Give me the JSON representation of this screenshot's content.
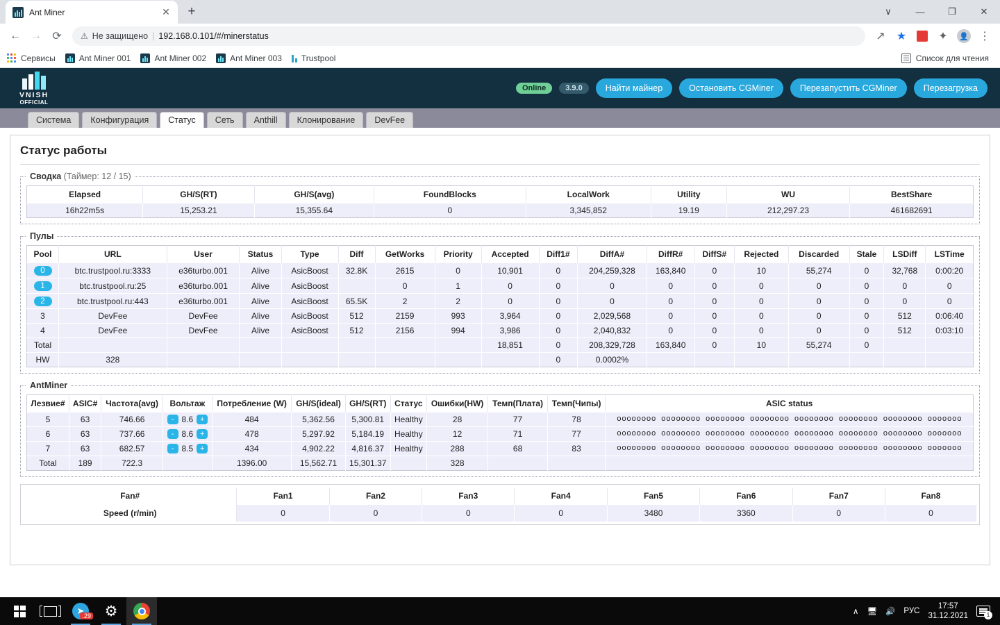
{
  "browser": {
    "tab": {
      "title": "Ant Miner",
      "close_label": "✕"
    },
    "new_tab_label": "+",
    "window_controls": {
      "minimize_tabs": "∨",
      "minimize": "—",
      "maximize": "❐",
      "close": "✕"
    },
    "nav": {
      "back": "←",
      "forward": "→",
      "reload": "⟳"
    },
    "omnibox": {
      "security_icon": "⚠",
      "security_label": "Не защищено",
      "separator": "|",
      "url": "192.168.0.101/#/minerstatus"
    },
    "toolbar_right": {
      "share": "↗",
      "bookmark_star": "★",
      "extension_red": "●",
      "extensions_puzzle": "✦",
      "profile": "●",
      "menu": "⋮"
    },
    "bookmarks": [
      {
        "label": "Сервисы",
        "icon": "apps-grid-icon"
      },
      {
        "label": "Ant Miner 001",
        "icon": "vnish-favicon"
      },
      {
        "label": "Ant Miner 002",
        "icon": "vnish-favicon"
      },
      {
        "label": "Ant Miner 003",
        "icon": "vnish-favicon"
      },
      {
        "label": "Trustpool",
        "icon": "bars-icon"
      }
    ],
    "reading_list": "Список для чтения"
  },
  "app": {
    "logo": {
      "text": "VNISH",
      "sub": "OFFICIAL"
    },
    "status_pill": "Online",
    "version_pill": "3.9.0",
    "buttons": [
      "Найти майнер",
      "Остановить CGMiner",
      "Перезапустить CGMiner",
      "Перезагрузка"
    ],
    "tabs": [
      {
        "label": "Система",
        "active": false
      },
      {
        "label": "Конфигурация",
        "active": false
      },
      {
        "label": "Статус",
        "active": true
      },
      {
        "label": "Сеть",
        "active": false
      },
      {
        "label": "Anthill",
        "active": false
      },
      {
        "label": "Клонирование",
        "active": false
      },
      {
        "label": "DevFee",
        "active": false
      }
    ],
    "page_title": "Статус работы"
  },
  "summary": {
    "legend": "Сводка",
    "legend_soft": "(Таймер: 12 / 15)",
    "headers": [
      "Elapsed",
      "GH/S(RT)",
      "GH/S(avg)",
      "FoundBlocks",
      "LocalWork",
      "Utility",
      "WU",
      "BestShare"
    ],
    "row": [
      "16h22m5s",
      "15,253.21",
      "15,355.64",
      "0",
      "3,345,852",
      "19.19",
      "212,297.23",
      "461682691"
    ]
  },
  "pools": {
    "legend": "Пулы",
    "headers": [
      "Pool",
      "URL",
      "User",
      "Status",
      "Type",
      "Diff",
      "GetWorks",
      "Priority",
      "Accepted",
      "Diff1#",
      "DiffA#",
      "DiffR#",
      "DiffS#",
      "Rejected",
      "Discarded",
      "Stale",
      "LSDiff",
      "LSTime"
    ],
    "rows": [
      {
        "badge": "0",
        "cells": [
          "btc.trustpool.ru:3333",
          "e36turbo.001",
          "Alive",
          "AsicBoost",
          "32.8K",
          "2615",
          "0",
          "10,901",
          "0",
          "204,259,328",
          "163,840",
          "0",
          "10",
          "55,274",
          "0",
          "32,768",
          "0:00:20"
        ]
      },
      {
        "badge": "1",
        "cells": [
          "btc.trustpool.ru:25",
          "e36turbo.001",
          "Alive",
          "AsicBoost",
          "",
          "0",
          "1",
          "0",
          "0",
          "0",
          "0",
          "0",
          "0",
          "0",
          "0",
          "0",
          "0"
        ]
      },
      {
        "badge": "2",
        "cells": [
          "btc.trustpool.ru:443",
          "e36turbo.001",
          "Alive",
          "AsicBoost",
          "65.5K",
          "2",
          "2",
          "0",
          "0",
          "0",
          "0",
          "0",
          "0",
          "0",
          "0",
          "0",
          "0"
        ]
      },
      {
        "badge": "3",
        "plain": true,
        "cells": [
          "DevFee",
          "DevFee",
          "Alive",
          "AsicBoost",
          "512",
          "2159",
          "993",
          "3,964",
          "0",
          "2,029,568",
          "0",
          "0",
          "0",
          "0",
          "0",
          "512",
          "0:06:40"
        ]
      },
      {
        "badge": "4",
        "plain": true,
        "cells": [
          "DevFee",
          "DevFee",
          "Alive",
          "AsicBoost",
          "512",
          "2156",
          "994",
          "3,986",
          "0",
          "2,040,832",
          "0",
          "0",
          "0",
          "0",
          "0",
          "512",
          "0:03:10"
        ]
      },
      {
        "badge": "Total",
        "plain": true,
        "cells": [
          "",
          "",
          "",
          "",
          "",
          "",
          "",
          "18,851",
          "0",
          "208,329,728",
          "163,840",
          "0",
          "10",
          "55,274",
          "0",
          "",
          ""
        ]
      },
      {
        "badge": "HW",
        "plain": true,
        "cells": [
          "328",
          "",
          "",
          "",
          "",
          "",
          "",
          "",
          "0",
          "0.0002%",
          "",
          "",
          "",
          "",
          "",
          "",
          ""
        ]
      }
    ]
  },
  "antminer": {
    "legend": "AntMiner",
    "headers": [
      "Лезвие#",
      "ASIC#",
      "Частота(avg)",
      "Вольтаж",
      "Потребление (W)",
      "GH/S(ideal)",
      "GH/S(RT)",
      "Статус",
      "Ошибки(HW)",
      "Темп(Плата)",
      "Темп(Чипы)",
      "ASIC status"
    ],
    "volt_minus": "-",
    "volt_plus": "+",
    "asic_status": "oooooooo oooooooo oooooooo oooooooo oooooooo oooooooo oooooooo ooooooo",
    "rows": [
      {
        "blade": "5",
        "asic": "63",
        "freq": "746.66",
        "voltage": "8.6",
        "power": "484",
        "ideal": "5,362.56",
        "rt": "5,300.81",
        "status": "Healthy",
        "hw": "28",
        "temp_board": "77",
        "temp_chip": "78"
      },
      {
        "blade": "6",
        "asic": "63",
        "freq": "737.66",
        "voltage": "8.6",
        "power": "478",
        "ideal": "5,297.92",
        "rt": "5,184.19",
        "status": "Healthy",
        "hw": "12",
        "temp_board": "71",
        "temp_chip": "77"
      },
      {
        "blade": "7",
        "asic": "63",
        "freq": "682.57",
        "voltage": "8.5",
        "power": "434",
        "ideal": "4,902.22",
        "rt": "4,816.37",
        "status": "Healthy",
        "hw": "288",
        "temp_board": "68",
        "temp_chip": "83"
      }
    ],
    "total": {
      "blade": "Total",
      "asic": "189",
      "freq": "722.3",
      "voltage": "",
      "power": "1396.00",
      "ideal": "15,562.71",
      "rt": "15,301.37",
      "status": "",
      "hw": "328",
      "temp_board": "",
      "temp_chip": ""
    }
  },
  "fans": {
    "headers": [
      "Fan#",
      "Fan1",
      "Fan2",
      "Fan3",
      "Fan4",
      "Fan5",
      "Fan6",
      "Fan7",
      "Fan8"
    ],
    "row_label": "Speed (r/min)",
    "speeds": [
      "0",
      "0",
      "0",
      "0",
      "3480",
      "3360",
      "0",
      "0"
    ]
  },
  "taskbar": {
    "start": "windows-logo-icon",
    "task_view": "task-view-icon",
    "telegram_badge": ".29",
    "tray": {
      "chevron": "∧",
      "language": "РУС",
      "time": "17:57",
      "date": "31.12.2021",
      "notifications": "1"
    }
  }
}
